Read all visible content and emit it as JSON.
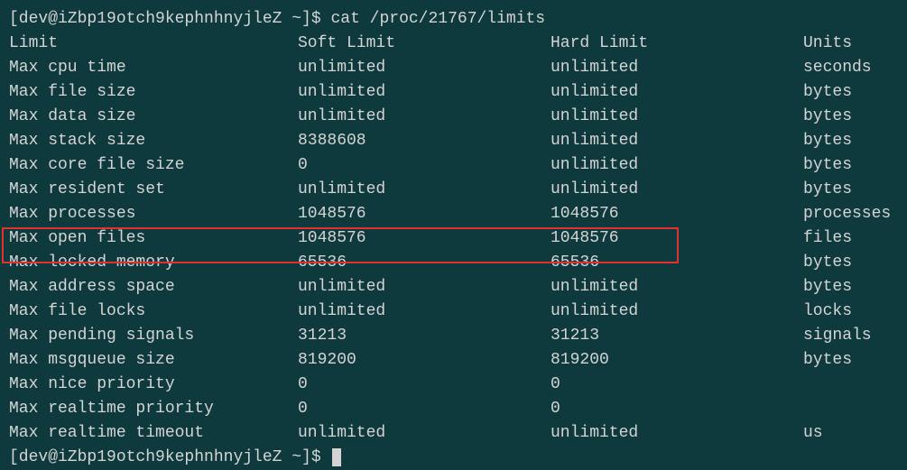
{
  "prompt": "[dev@iZbp19otch9kephnhnyjleZ ~]$",
  "command": "cat /proc/21767/limits",
  "prompt2": "[dev@iZbp19otch9kephnhnyjleZ ~]$",
  "header": {
    "limit": "Limit",
    "soft": "Soft Limit",
    "hard": "Hard Limit",
    "units": "Units"
  },
  "rows": [
    {
      "limit": "Max cpu time",
      "soft": "unlimited",
      "hard": "unlimited",
      "units": "seconds"
    },
    {
      "limit": "Max file size",
      "soft": "unlimited",
      "hard": "unlimited",
      "units": "bytes"
    },
    {
      "limit": "Max data size",
      "soft": "unlimited",
      "hard": "unlimited",
      "units": "bytes"
    },
    {
      "limit": "Max stack size",
      "soft": "8388608",
      "hard": "unlimited",
      "units": "bytes"
    },
    {
      "limit": "Max core file size",
      "soft": "0",
      "hard": "unlimited",
      "units": "bytes"
    },
    {
      "limit": "Max resident set",
      "soft": "unlimited",
      "hard": "unlimited",
      "units": "bytes"
    },
    {
      "limit": "Max processes",
      "soft": "1048576",
      "hard": "1048576",
      "units": "processes"
    },
    {
      "limit": "Max open files",
      "soft": "1048576",
      "hard": "1048576",
      "units": "files"
    },
    {
      "limit": "Max locked memory",
      "soft": "65536",
      "hard": "65536",
      "units": "bytes"
    },
    {
      "limit": "Max address space",
      "soft": "unlimited",
      "hard": "unlimited",
      "units": "bytes"
    },
    {
      "limit": "Max file locks",
      "soft": "unlimited",
      "hard": "unlimited",
      "units": "locks"
    },
    {
      "limit": "Max pending signals",
      "soft": "31213",
      "hard": "31213",
      "units": "signals"
    },
    {
      "limit": "Max msgqueue size",
      "soft": "819200",
      "hard": "819200",
      "units": "bytes"
    },
    {
      "limit": "Max nice priority",
      "soft": "0",
      "hard": "0",
      "units": ""
    },
    {
      "limit": "Max realtime priority",
      "soft": "0",
      "hard": "0",
      "units": ""
    },
    {
      "limit": "Max realtime timeout",
      "soft": "unlimited",
      "hard": "unlimited",
      "units": "us"
    }
  ]
}
